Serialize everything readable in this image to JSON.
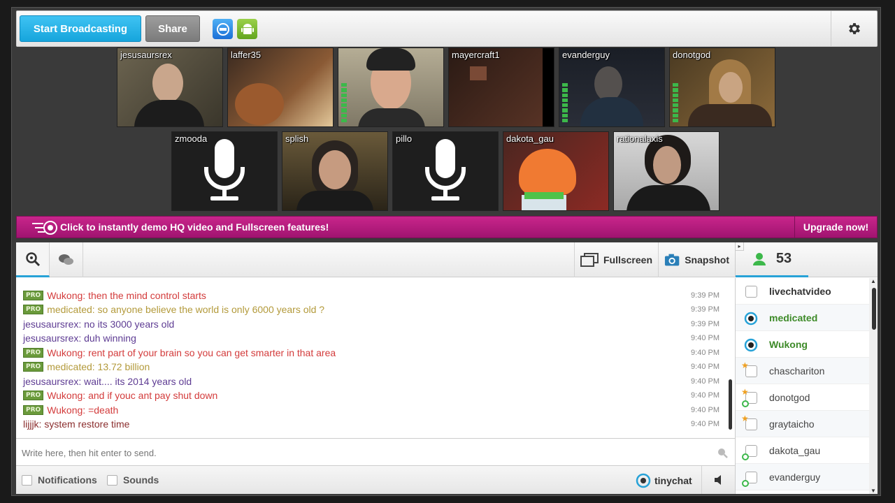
{
  "toolbar": {
    "broadcast_label": "Start Broadcasting",
    "share_label": "Share"
  },
  "cams_row1": [
    {
      "name": "jesusaursrex"
    },
    {
      "name": "laffer35"
    },
    {
      "name": ""
    },
    {
      "name": "mayercraft1"
    },
    {
      "name": "evanderguy"
    },
    {
      "name": "donotgod"
    }
  ],
  "cams_row2": [
    {
      "name": "zmooda"
    },
    {
      "name": "splish"
    },
    {
      "name": "pillo"
    },
    {
      "name": "dakota_gau"
    },
    {
      "name": "rationalaxis"
    }
  ],
  "promo": {
    "text": "Click to instantly demo HQ video and Fullscreen features!",
    "upgrade_label": "Upgrade now!"
  },
  "chat_tools": {
    "fullscreen_label": "Fullscreen",
    "snapshot_label": "Snapshot"
  },
  "user_count": "53",
  "messages": [
    {
      "pro": "PRO",
      "text": "Wukong: then the mind control starts",
      "time": "9:39 PM"
    },
    {
      "pro": "PRO",
      "text": "medicated: so anyone believe the world is only 6000 years old ?",
      "time": "9:39 PM"
    },
    {
      "pro": "",
      "text": "jesusaursrex: no its 3000 years old",
      "time": "9:39 PM"
    },
    {
      "pro": "",
      "text": "jesusaursrex: duh winning",
      "time": "9:40 PM"
    },
    {
      "pro": "PRO",
      "text": "Wukong: rent part of your brain so you can get smarter in that area",
      "time": "9:40 PM"
    },
    {
      "pro": "PRO",
      "text": "medicated: 13.72 billion",
      "time": "9:40 PM"
    },
    {
      "pro": "",
      "text": "jesusaursrex: wait.... its 2014 years old",
      "time": "9:40 PM"
    },
    {
      "pro": "PRO",
      "text": "Wukong: and if youc ant pay shut down",
      "time": "9:40 PM"
    },
    {
      "pro": "PRO",
      "text": "Wukong: =death",
      "time": "9:40 PM"
    },
    {
      "pro": "",
      "text": "lijjjk: system restore time",
      "time": "9:40 PM"
    }
  ],
  "input": {
    "placeholder": "Write here, then hit enter to send."
  },
  "bottom": {
    "notifications_label": "Notifications",
    "sounds_label": "Sounds",
    "brand": "tinychat"
  },
  "users": [
    {
      "name": "livechatvideo"
    },
    {
      "name": "medicated"
    },
    {
      "name": "Wukong"
    },
    {
      "name": "chaschariton"
    },
    {
      "name": "donotgod"
    },
    {
      "name": "graytaicho"
    },
    {
      "name": "dakota_gau"
    },
    {
      "name": "evanderguy"
    }
  ],
  "colors": {
    "accent_blue": "#1fb0e6",
    "promo_magenta": "#b51b7e",
    "pro_badge": "#6a9a3b",
    "msg_red": "#d33b3b",
    "msg_olive": "#b39a3b",
    "msg_purple": "#5e3c93",
    "op_green": "#3d8a28"
  }
}
